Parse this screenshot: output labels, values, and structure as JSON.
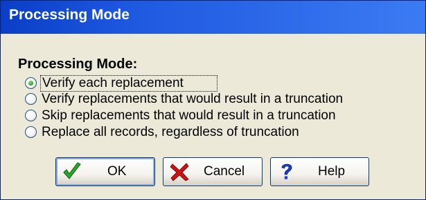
{
  "window": {
    "title": "Processing Mode"
  },
  "group": {
    "label": "Processing Mode:"
  },
  "options": [
    {
      "label": "Verify each replacement",
      "checked": true
    },
    {
      "label": "Verify replacements that would result in a truncation",
      "checked": false
    },
    {
      "label": "Skip replacements that would result in a truncation",
      "checked": false
    },
    {
      "label": "Replace all records, regardless of truncation",
      "checked": false
    }
  ],
  "buttons": {
    "ok": {
      "label": "OK",
      "icon": "check-icon"
    },
    "cancel": {
      "label": "Cancel",
      "icon": "x-icon"
    },
    "help": {
      "label": "Help",
      "icon": "question-icon"
    }
  },
  "colors": {
    "titlebar": "#1e58e0",
    "dialog_bg": "#ece9d8",
    "check_green": "#2fa52a",
    "cancel_red": "#c81414",
    "help_blue": "#1a3ccf"
  }
}
